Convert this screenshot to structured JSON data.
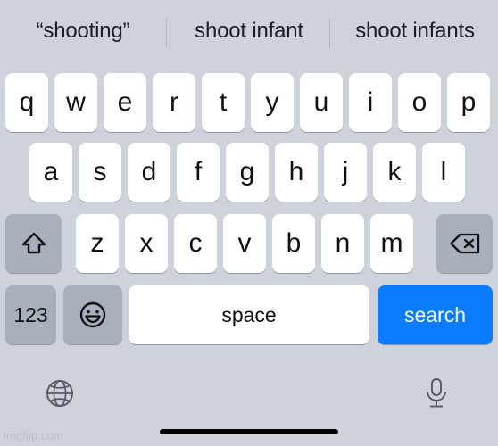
{
  "app": {
    "name": "iOS Keyboard",
    "background_color": "#ced2da",
    "accent_color": "#0a7cff"
  },
  "suggestion_bar": {
    "items": [
      {
        "label": "“shooting”"
      },
      {
        "label": "shoot infant"
      },
      {
        "label": "shoot infants"
      }
    ]
  },
  "keyboard": {
    "row1": [
      {
        "label": "q"
      },
      {
        "label": "w"
      },
      {
        "label": "e"
      },
      {
        "label": "r"
      },
      {
        "label": "t"
      },
      {
        "label": "y"
      },
      {
        "label": "u"
      },
      {
        "label": "i"
      },
      {
        "label": "o"
      },
      {
        "label": "p"
      }
    ],
    "row2": [
      {
        "label": "a"
      },
      {
        "label": "s"
      },
      {
        "label": "d"
      },
      {
        "label": "f"
      },
      {
        "label": "g"
      },
      {
        "label": "h"
      },
      {
        "label": "j"
      },
      {
        "label": "k"
      },
      {
        "label": "l"
      }
    ],
    "row3": [
      {
        "label": "z"
      },
      {
        "label": "x"
      },
      {
        "label": "c"
      },
      {
        "label": "v"
      },
      {
        "label": "b"
      },
      {
        "label": "n"
      },
      {
        "label": "m"
      }
    ],
    "shift": {
      "icon": "shift-arrow-icon"
    },
    "backspace": {
      "icon": "backspace-delete-icon"
    },
    "numeric": {
      "label": "123"
    },
    "emoji": {
      "icon": "emoji-smiley-icon"
    },
    "space": {
      "label": "space"
    },
    "search": {
      "label": "search",
      "color": "#0a7cff"
    }
  },
  "bottom_bar": {
    "globe": {
      "icon": "globe-icon"
    },
    "microphone": {
      "icon": "microphone-icon"
    }
  },
  "watermark": {
    "label": "imgflip.com"
  }
}
